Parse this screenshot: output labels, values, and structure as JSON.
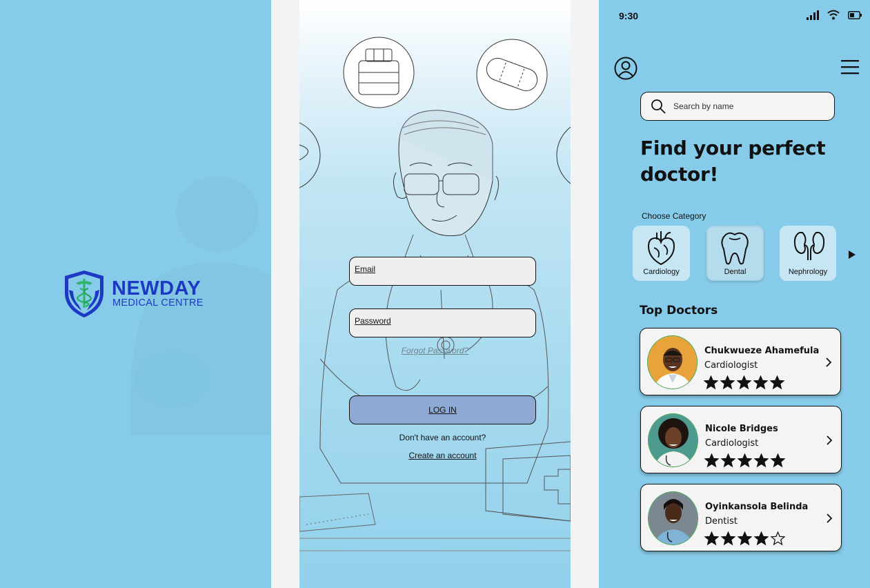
{
  "splash": {
    "brand": "NEWDAY",
    "subtitle": "MEDICAL CENTRE"
  },
  "login": {
    "email_placeholder": "Email",
    "password_placeholder": "Password",
    "forgot_password": "Forgot Password?",
    "login_button": "LOG IN",
    "no_account_text": "Don't have an account?",
    "create_account": "Create an account"
  },
  "home": {
    "status_time": "9:30",
    "search_placeholder": "Search by name",
    "headline": "Find your perfect doctor!",
    "choose_category": "Choose Category",
    "categories": [
      {
        "label": "Cardiology",
        "icon": "heart-icon",
        "selected": false
      },
      {
        "label": "Dental",
        "icon": "tooth-icon",
        "selected": true
      },
      {
        "label": "Nephrology",
        "icon": "kidney-icon",
        "selected": false
      }
    ],
    "top_doctors_title": "Top Doctors",
    "doctors": [
      {
        "name": "Chukwueze Ahamefula",
        "specialty": "Cardiologist",
        "rating": 5,
        "max_rating": 5
      },
      {
        "name": "Nicole Bridges",
        "specialty": "Cardiologist",
        "rating": 5,
        "max_rating": 5
      },
      {
        "name": "Oyinkansola Belinda",
        "specialty": "Dentist",
        "rating": 4,
        "max_rating": 5
      }
    ]
  },
  "colors": {
    "panel_blue": "#86cbe9",
    "brand_blue": "#1d39c4",
    "brand_green": "#2fb56a",
    "login_button": "#8da9d4",
    "card_bg": "#f4f4f4"
  }
}
